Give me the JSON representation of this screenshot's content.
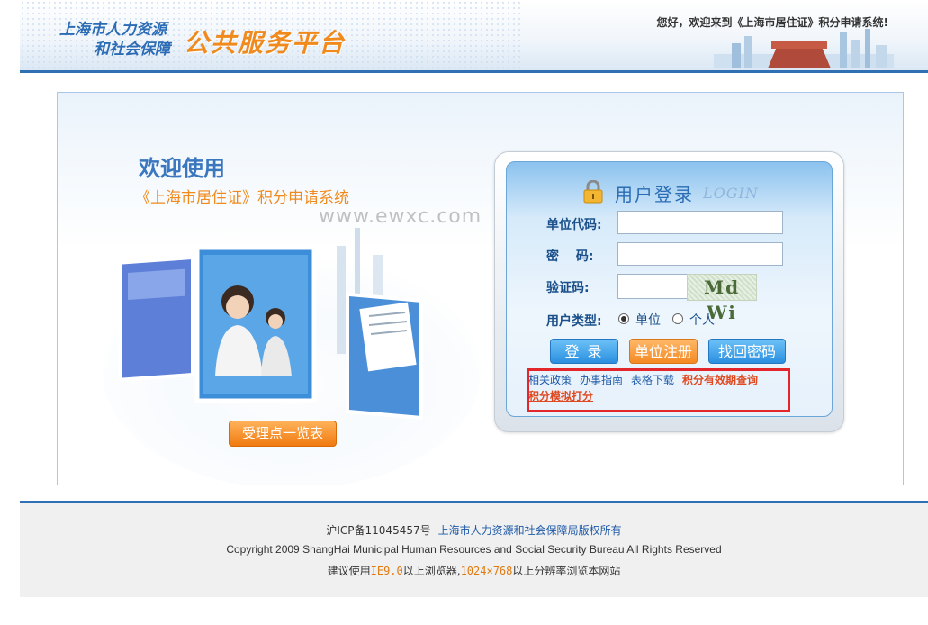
{
  "header": {
    "logo_line1": "上海市人力资源",
    "logo_line2": "和社会保障",
    "logo_brand": "公共服务平台",
    "welcome": "您好，欢迎来到《上海市居住证》积分申请系统!"
  },
  "promo": {
    "title": "欢迎使用",
    "subtitle": "《上海市居住证》积分申请系统",
    "list_button": "受理点一览表"
  },
  "watermark": "www.ewxc.com",
  "login": {
    "title": "用户登录",
    "title_en": "LOGIN",
    "unit_code_label": "单位代码:",
    "password_label": "密　 码:",
    "captcha_label": "验证码:",
    "captcha_text": "Md Wi",
    "user_type_label": "用户类型:",
    "user_type_options": [
      "单位",
      "个人"
    ],
    "user_type_selected": "单位",
    "buttons": {
      "login": "登 录",
      "register": "单位注册",
      "recover": "找回密码"
    },
    "links": [
      "相关政策",
      "办事指南",
      "表格下载",
      "积分有效期查询",
      "积分模拟打分"
    ]
  },
  "footer": {
    "icp": "沪ICP备11045457号",
    "org": "上海市人力资源和社会保障局版权所有",
    "copyright": "Copyright 2009 ShangHai Municipal Human Resources and Social Security Bureau All Rights Reserved",
    "browser_prefix": "建议使用",
    "browser_name": "IE9.0",
    "browser_mid": "以上浏览器,",
    "resolution": "1024×768",
    "browser_suffix": "以上分辨率浏览本网站"
  },
  "colors": {
    "brand_blue": "#2b6cb5",
    "brand_orange": "#f08a1c",
    "highlight_red": "#e2262a"
  }
}
